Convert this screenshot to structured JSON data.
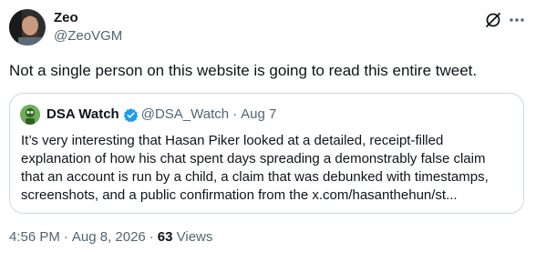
{
  "author": {
    "name": "Zeo",
    "handle": "@ZeoVGM"
  },
  "tweet": {
    "text": "Not a single person on this website is going to read this entire tweet."
  },
  "quote": {
    "name": "DSA Watch",
    "handle": "@DSA_Watch",
    "separator": "·",
    "date": "Aug 7",
    "lines": [
      "It’s very interesting that Hasan Piker looked at a detailed, receipt-filled",
      "explanation of how his chat spent days spreading a demonstrably false claim",
      "that an account is run by a child, a claim that was debunked with timestamps,",
      "screenshots, and a public confirmation from the x.com/hasanthehun/st..."
    ]
  },
  "meta": {
    "time": "4:56 PM",
    "separator": "·",
    "date": "Aug 8, 2026",
    "views_count": "63",
    "views_label": "Views"
  },
  "colors": {
    "text_primary": "#0f1419",
    "text_secondary": "#536471",
    "border": "#cfd9de",
    "verified": "#1d9bf0"
  },
  "icons": {
    "grok": "grok-icon",
    "more": "more-horizontal-icon",
    "verified": "verified-badge-icon"
  }
}
